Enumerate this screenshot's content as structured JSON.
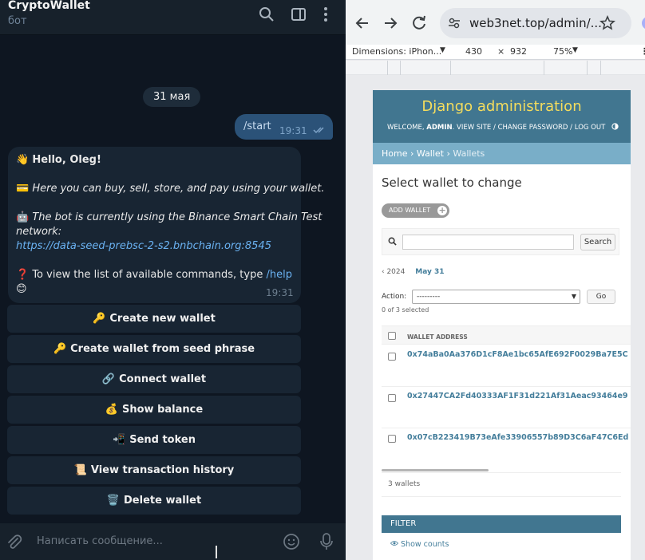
{
  "telegram": {
    "chat_title": "CryptoWallet",
    "chat_subtitle": "бот",
    "date_badge": "31 мая",
    "outgoing": {
      "text": "/start",
      "time": "19:31"
    },
    "incoming": {
      "greeting_emoji": "👋",
      "greeting": "Hello, Oleg!",
      "line1_emoji": "💳",
      "line1": "Here you can buy, sell, store, and pay using your wallet.",
      "line2_emoji": "🤖",
      "line2a": "The bot is currently using the Binance Smart Chain Test",
      "line2b": "network:",
      "link": "https://data-seed-prebsc-2-s2.bnbchain.org:8545",
      "help_emoji": "❓",
      "help_text": "To view the list of available commands, type",
      "help_cmd": "/help",
      "help_end_emoji": "😊",
      "time": "19:31"
    },
    "keyboard": [
      {
        "emoji": "🔑",
        "label": "Create new wallet"
      },
      {
        "emoji": "🔑",
        "label": "Create wallet from seed phrase"
      },
      {
        "emoji": "🔗",
        "label": "Connect wallet"
      },
      {
        "emoji": "💰",
        "label": "Show balance"
      },
      {
        "emoji": "📲",
        "label": "Send token"
      },
      {
        "emoji": "📜",
        "label": "View transaction history"
      },
      {
        "emoji": "🗑️",
        "label": "Delete wallet"
      }
    ],
    "composer_placeholder": "Написать сообщение..."
  },
  "browser": {
    "url": "web3net.top/admin/...",
    "devtools": {
      "device": "Dimensions: iPhon...",
      "width": "430",
      "times": "×",
      "height": "932",
      "zoom": "75%"
    },
    "admin": {
      "brand": "Django administration",
      "welcome": "WELCOME,",
      "user": "ADMIN",
      "view_site": "VIEW SITE",
      "change_password": "CHANGE PASSWORD",
      "log_out": "LOG OUT",
      "breadcrumb": {
        "home": "Home",
        "wallet": "Wallet",
        "current": "Wallets"
      },
      "title": "Select wallet to change",
      "add_button": "ADD WALLET",
      "search_button": "Search",
      "date_back": "‹ 2024",
      "date_current": "May 31",
      "action_label": "Action:",
      "action_value": "---------",
      "go_button": "Go",
      "selected_count": "0 of 3 selected",
      "column_header": "WALLET ADDRESS",
      "wallets": [
        "0x74aBa0Aa376D1cF8Ae1bc65AfE692F0029Ba7E5C",
        "0x27447CA2Fd40333AF1F31d221Af31Aeac93464e9",
        "0x07cB223419B73eAfe33906557b89D3C6aF47C6Ed"
      ],
      "result_count": "3 wallets",
      "filter_title": "FILTER",
      "show_counts": "Show counts"
    }
  },
  "colors": {
    "telegram_bg": "#0e1621",
    "telegram_bubble_in": "#182533",
    "telegram_bubble_out": "#2b5278",
    "django_primary": "#417690",
    "django_secondary": "#79aec8",
    "django_accent": "#f5dd5d"
  }
}
